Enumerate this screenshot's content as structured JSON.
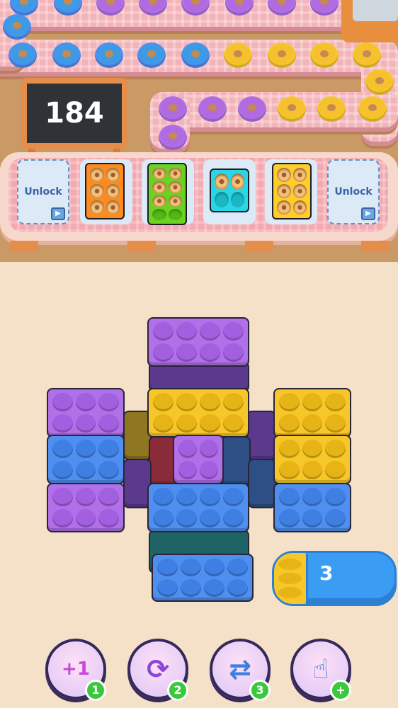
{
  "level": {
    "number": "184"
  },
  "slots": {
    "left_locked_label": "Unlock",
    "right_locked_label": "Unlock",
    "trays": [
      {
        "color": "orange",
        "filled": 0,
        "capacity": 6
      },
      {
        "color": "green",
        "filled": 6,
        "capacity": 8
      },
      {
        "color": "cyan",
        "filled": 2,
        "capacity": 4
      },
      {
        "color": "yellow",
        "filled": 6,
        "capacity": 6
      }
    ]
  },
  "conveyor": {
    "donut_colors": [
      "blue",
      "yellow",
      "purple"
    ]
  },
  "counter": {
    "value": "3",
    "color": "yellow"
  },
  "boosters": [
    {
      "name": "add-one",
      "glyph": "+1",
      "count": "1"
    },
    {
      "name": "shuffle",
      "glyph": "⟳",
      "count": "2"
    },
    {
      "name": "swap",
      "glyph": "⇄",
      "count": "3"
    },
    {
      "name": "hand",
      "glyph": "☝",
      "count": "+"
    }
  ],
  "colors": {
    "purple": "#b070e8",
    "yellow": "#f7c729",
    "blue": "#4f8ff0",
    "badge": "#3cc83c"
  }
}
